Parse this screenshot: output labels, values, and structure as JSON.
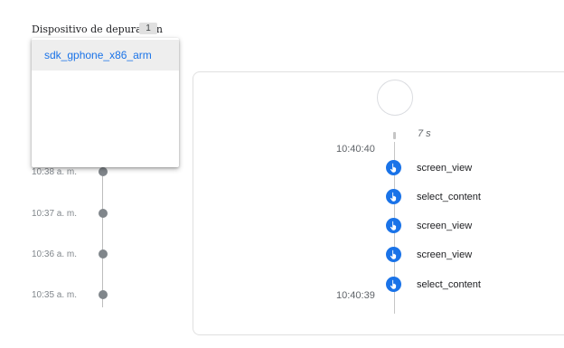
{
  "header": {
    "device_label": "Dispositivo de depuración",
    "device_count": "1"
  },
  "device_menu": {
    "options": [
      "sdk_gphone_x86_arm"
    ]
  },
  "left_timeline": {
    "times": [
      "10:38 a. m.",
      "10:37 a. m.",
      "10:36 a. m.",
      "10:35 a. m."
    ]
  },
  "event_panel": {
    "duration": "7 s",
    "start_time": "10:40:40",
    "end_time": "10:40:39",
    "events": [
      "screen_view",
      "select_content",
      "screen_view",
      "screen_view",
      "select_content"
    ],
    "icon": "touch-icon",
    "accent": "#1a73e8"
  }
}
